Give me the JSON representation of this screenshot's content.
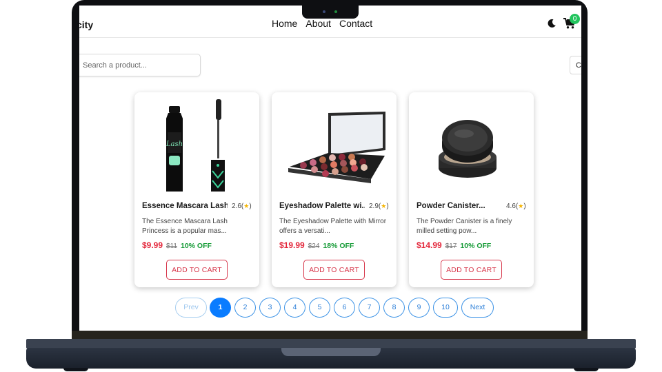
{
  "nav": {
    "brand": "city",
    "links": [
      "Home",
      "About",
      "Contact"
    ],
    "cart_count": "0",
    "icons": [
      "moon-icon",
      "cart-icon"
    ]
  },
  "search": {
    "placeholder": "Search a product...",
    "right_box": "C"
  },
  "products": [
    {
      "title": "Essence Mascara Lash...",
      "rating": "2.6",
      "description": "The Essence Mascara Lash Princess is a popular mas...",
      "price": "$9.99",
      "old_price": "$11",
      "discount": "10% OFF",
      "button": "ADD TO CART"
    },
    {
      "title": "Eyeshadow Palette wi...",
      "rating": "2.9",
      "description": "The Eyeshadow Palette with Mirror offers a versati...",
      "price": "$19.99",
      "old_price": "$24",
      "discount": "18% OFF",
      "button": "ADD TO CART"
    },
    {
      "title": "Powder Canister...",
      "rating": "4.6",
      "description": "The Powder Canister is a finely milled setting pow...",
      "price": "$14.99",
      "old_price": "$17",
      "discount": "10% OFF",
      "button": "ADD TO CART"
    }
  ],
  "pagination": {
    "prev": "Prev",
    "next": "Next",
    "pages": [
      "1",
      "2",
      "3",
      "4",
      "5",
      "6",
      "7",
      "8",
      "9",
      "10"
    ],
    "active": "1"
  },
  "colors": {
    "price": "#e3263a",
    "discount": "#169b37",
    "accent": "#0a7cff",
    "button": "#d7374b",
    "badge": "#22c55e"
  }
}
